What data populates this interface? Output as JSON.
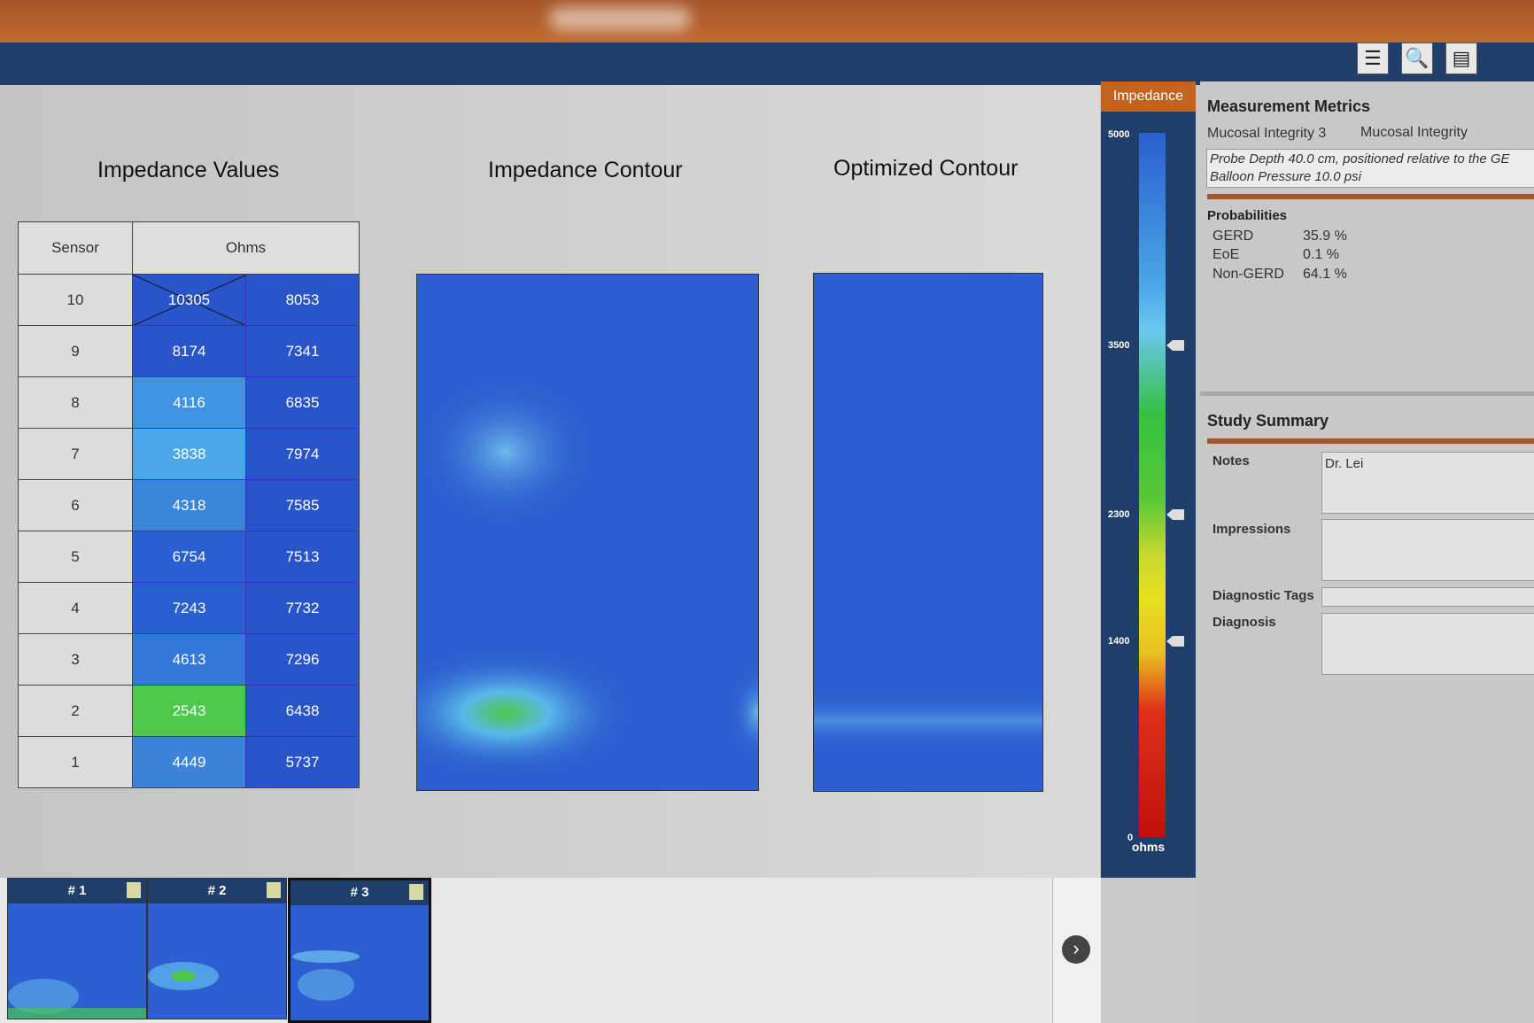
{
  "toolbar": {
    "icons": [
      "list-icon",
      "magnifier-icon",
      "document-icon"
    ]
  },
  "headings": {
    "values": "Impedance Values",
    "contour": "Impedance Contour",
    "optimized": "Optimized Contour"
  },
  "table": {
    "col_sensor": "Sensor",
    "col_ohms": "Ohms",
    "rows": [
      {
        "sensor": "10",
        "a": "10305",
        "b": "8053",
        "a_color": "#2a55c8",
        "b_color": "#2a55c8"
      },
      {
        "sensor": "9",
        "a": "8174",
        "b": "7341",
        "a_color": "#2a55c8",
        "b_color": "#2a55c8"
      },
      {
        "sensor": "8",
        "a": "4116",
        "b": "6835",
        "a_color": "#3f93e0",
        "b_color": "#2a55c8"
      },
      {
        "sensor": "7",
        "a": "3838",
        "b": "7974",
        "a_color": "#4aa8e8",
        "b_color": "#2a55c8"
      },
      {
        "sensor": "6",
        "a": "4318",
        "b": "7585",
        "a_color": "#3a85db",
        "b_color": "#2a55c8"
      },
      {
        "sensor": "5",
        "a": "6754",
        "b": "7513",
        "a_color": "#2a5fd0",
        "b_color": "#2a55c8"
      },
      {
        "sensor": "4",
        "a": "7243",
        "b": "7732",
        "a_color": "#2a5fd0",
        "b_color": "#2a55c8"
      },
      {
        "sensor": "3",
        "a": "4613",
        "b": "7296",
        "a_color": "#3478d8",
        "b_color": "#2a55c8"
      },
      {
        "sensor": "2",
        "a": "2543",
        "b": "6438",
        "a_color": "#4cc84a",
        "b_color": "#2a55c8"
      },
      {
        "sensor": "1",
        "a": "4449",
        "b": "5737",
        "a_color": "#3a82da",
        "b_color": "#2a55c8"
      }
    ]
  },
  "scale": {
    "title": "Impedance",
    "ticks": [
      "5000",
      "3500",
      "2300",
      "1400",
      "0"
    ],
    "unit": "ohms"
  },
  "metrics": {
    "title": "Measurement Metrics",
    "label1": "Mucosal Integrity 3",
    "label2": "Mucosal Integrity",
    "probe_line": "Probe Depth 40.0 cm, positioned relative to the GE",
    "balloon_line": "Balloon Pressure 10.0 psi",
    "prob_title": "Probabilities",
    "probs": [
      {
        "name": "GERD",
        "value": "35.9 %"
      },
      {
        "name": "EoE",
        "value": "0.1 %"
      },
      {
        "name": "Non-GERD",
        "value": "64.1 %"
      }
    ]
  },
  "summary": {
    "title": "Study Summary",
    "notes_label": "Notes",
    "notes_value": "Dr. Lei",
    "impressions_label": "Impressions",
    "tags_label": "Diagnostic Tags",
    "diagnosis_label": "Diagnosis"
  },
  "thumbs": [
    "# 1",
    "# 2",
    "# 3"
  ]
}
